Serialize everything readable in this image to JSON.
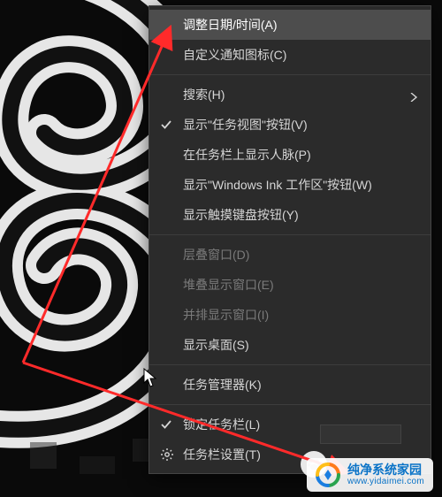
{
  "menu": {
    "items": [
      {
        "label": "调整日期/时间(A)",
        "highlight": true
      },
      {
        "label": "自定义通知图标(C)"
      },
      {
        "divider": true
      },
      {
        "label": "搜索(H)",
        "submenu": true
      },
      {
        "label": "显示\"任务视图\"按钮(V)",
        "checked": true
      },
      {
        "label": "在任务栏上显示人脉(P)"
      },
      {
        "label": "显示\"Windows Ink 工作区\"按钮(W)"
      },
      {
        "label": "显示触摸键盘按钮(Y)"
      },
      {
        "divider": true
      },
      {
        "label": "层叠窗口(D)",
        "disabled": true
      },
      {
        "label": "堆叠显示窗口(E)",
        "disabled": true
      },
      {
        "label": "并排显示窗口(I)",
        "disabled": true
      },
      {
        "label": "显示桌面(S)"
      },
      {
        "divider": true
      },
      {
        "label": "任务管理器(K)"
      },
      {
        "divider": true
      },
      {
        "label": "锁定任务栏(L)",
        "checked": true
      },
      {
        "label": "任务栏设置(T)",
        "icon": "gear"
      }
    ]
  },
  "logo": {
    "title": "纯净系统家园",
    "url": "www.yidaimei.com"
  },
  "colors": {
    "menu_bg": "#2b2b2b",
    "highlight": "#4d4d4d",
    "text": "#d6d6d6",
    "disabled": "#7a7a7a",
    "arrow": "#ff2a2a"
  }
}
